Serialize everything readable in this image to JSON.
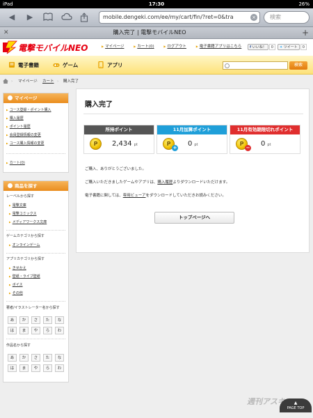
{
  "status_bar": {
    "device": "iPad",
    "wifi_icon": "wifi-icon",
    "time": "17:30",
    "battery": "26%"
  },
  "browser": {
    "url": "mobile.dengeki.com/ee/my/cart/fin/?ret=0&tra",
    "search_placeholder": "検索",
    "tab_title": "購入完了 | 電撃モバイルNEO"
  },
  "site": {
    "logo_text": "電撃モバイルNEO",
    "header_links": [
      "マイページ",
      "カート(0)",
      "ログアウト",
      "電子書籍アプリはこちら"
    ],
    "like_label": "いいね！",
    "like_count": "0",
    "tweet_label": "ツイート",
    "tweet_count": "0",
    "categories": [
      {
        "label": "電子書籍",
        "icon": "book-icon"
      },
      {
        "label": "ゲーム",
        "icon": "gamepad-icon"
      },
      {
        "label": "アプリ",
        "icon": "app-icon"
      }
    ],
    "search_button": "検索"
  },
  "breadcrumb": [
    "マイページ",
    "カート",
    "購入完了"
  ],
  "sidebar": {
    "mypage": {
      "title": "マイページ",
      "links": [
        "コース登録・ポイント購入",
        "購入履歴",
        "ポイント履歴",
        "会員登録情報の変更",
        "コース購入情報の変更"
      ],
      "cart_link": "カート(0)"
    },
    "products": {
      "title": "商品を探す",
      "label_group": "レーベルから探す",
      "label_links": [
        "電撃文庫",
        "電撃コミックス",
        "メディアワークス文庫"
      ],
      "game_group": "ゲームカテゴリから探す",
      "game_links": [
        "オンラインゲーム"
      ],
      "app_group": "アプリカテゴリから探す",
      "app_links": [
        "きせかえ",
        "壁紙・ライブ壁紙",
        "ボイス",
        "その他"
      ],
      "author_group": "著者/イラストレーター名から探す",
      "kana_row1": [
        "あ",
        "か",
        "さ",
        "た",
        "な"
      ],
      "kana_row2": [
        "は",
        "ま",
        "や",
        "ら",
        "わ"
      ],
      "work_group": "作品名から探す"
    }
  },
  "main": {
    "title": "購入完了",
    "points": [
      {
        "header": "所持ポイント",
        "value": "2,434",
        "unit": "pt",
        "color": "#555555"
      },
      {
        "header": "11月加算ポイント",
        "value": "0",
        "unit": "pt",
        "color": "#1f9fd9"
      },
      {
        "header": "11月有効期限切れポイント",
        "value": "0",
        "unit": "pt",
        "color": "#e02e2e"
      }
    ],
    "thanks": "ご購入、ありがとうございました。",
    "msg1_pre": "ご購入いただきましたゲームやアプリは、",
    "msg1_link": "購入履歴",
    "msg1_post": "よりダウンロードいただけます。",
    "msg2_pre": "電子書籍に関しては、",
    "msg2_link": "専用ビューア",
    "msg2_post": "をダウンロードしていただきお読みください。",
    "top_button": "トップページへ"
  },
  "page_top": "PAGE TOP",
  "watermark": "週刊アスキー"
}
